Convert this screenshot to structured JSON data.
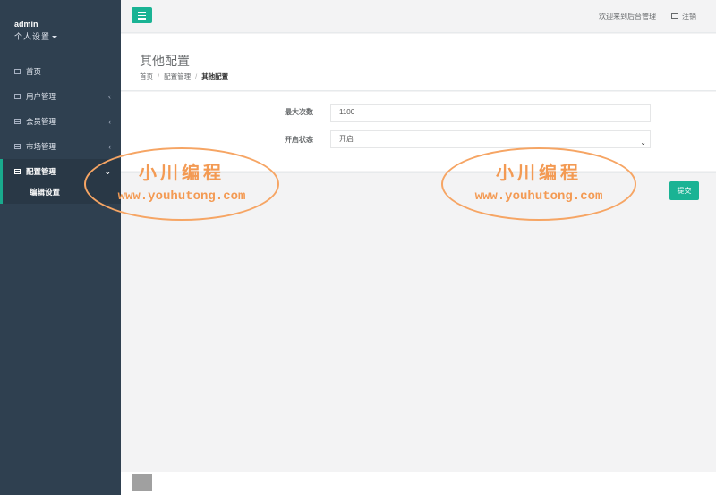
{
  "sidebar": {
    "user_name": "admin",
    "settings_label": "个人设置",
    "items": [
      {
        "label": "首页"
      },
      {
        "label": "用户管理"
      },
      {
        "label": "会员管理"
      },
      {
        "label": "市场管理"
      },
      {
        "label": "配置管理"
      }
    ],
    "sub_items": [
      {
        "label": "编辑设置"
      }
    ]
  },
  "topbar": {
    "welcome": "欢迎来到后台管理",
    "logout": "注销"
  },
  "heading": {
    "title": "其他配置",
    "breadcrumb": [
      "首页",
      "配置管理",
      "其他配置"
    ]
  },
  "form": {
    "max_count_label": "最大次数",
    "max_count_value": "1100",
    "status_label": "开启状态",
    "status_value": "开启",
    "submit_label": "提交"
  },
  "watermark": {
    "name": "小川编程",
    "url": "www.youhutong.com"
  },
  "colors": {
    "sidebar": "#2f4050",
    "accent": "#1ab394",
    "watermark": "#f39a53"
  }
}
